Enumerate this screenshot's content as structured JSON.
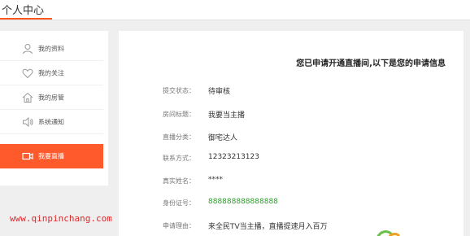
{
  "header": {
    "title": "个人中心"
  },
  "sidebar": {
    "items": [
      {
        "label": "我的资料",
        "icon": "user-icon"
      },
      {
        "label": "我的关注",
        "icon": "heart-icon"
      },
      {
        "label": "我的房管",
        "icon": "house-icon"
      },
      {
        "label": "系统通知",
        "icon": "speaker-icon"
      },
      {
        "label": "我要直播",
        "icon": "video-camera-icon",
        "active": true
      }
    ]
  },
  "main": {
    "heading": "您已申请开通直播间,以下是您的申请信息",
    "fields": [
      {
        "label": "提交状态：",
        "value": "待审核"
      },
      {
        "label": "房间标题：",
        "value": "我要当主播"
      },
      {
        "label": "直播分类：",
        "value": "御宅达人"
      },
      {
        "label": "联系方式：",
        "value": "12323213123"
      },
      {
        "label": "真实姓名：",
        "value": "****"
      },
      {
        "label": "身份证号：",
        "value": "888888888888888"
      },
      {
        "label": "申请理由：",
        "value": "来全民TV当主播，直播提速月入百万"
      }
    ]
  },
  "watermark": {
    "text": "www.qinpinchang.com"
  },
  "colors": {
    "accent": "#ff5a2c",
    "green": "#2e9b2e",
    "watermark": "#e0262b"
  }
}
